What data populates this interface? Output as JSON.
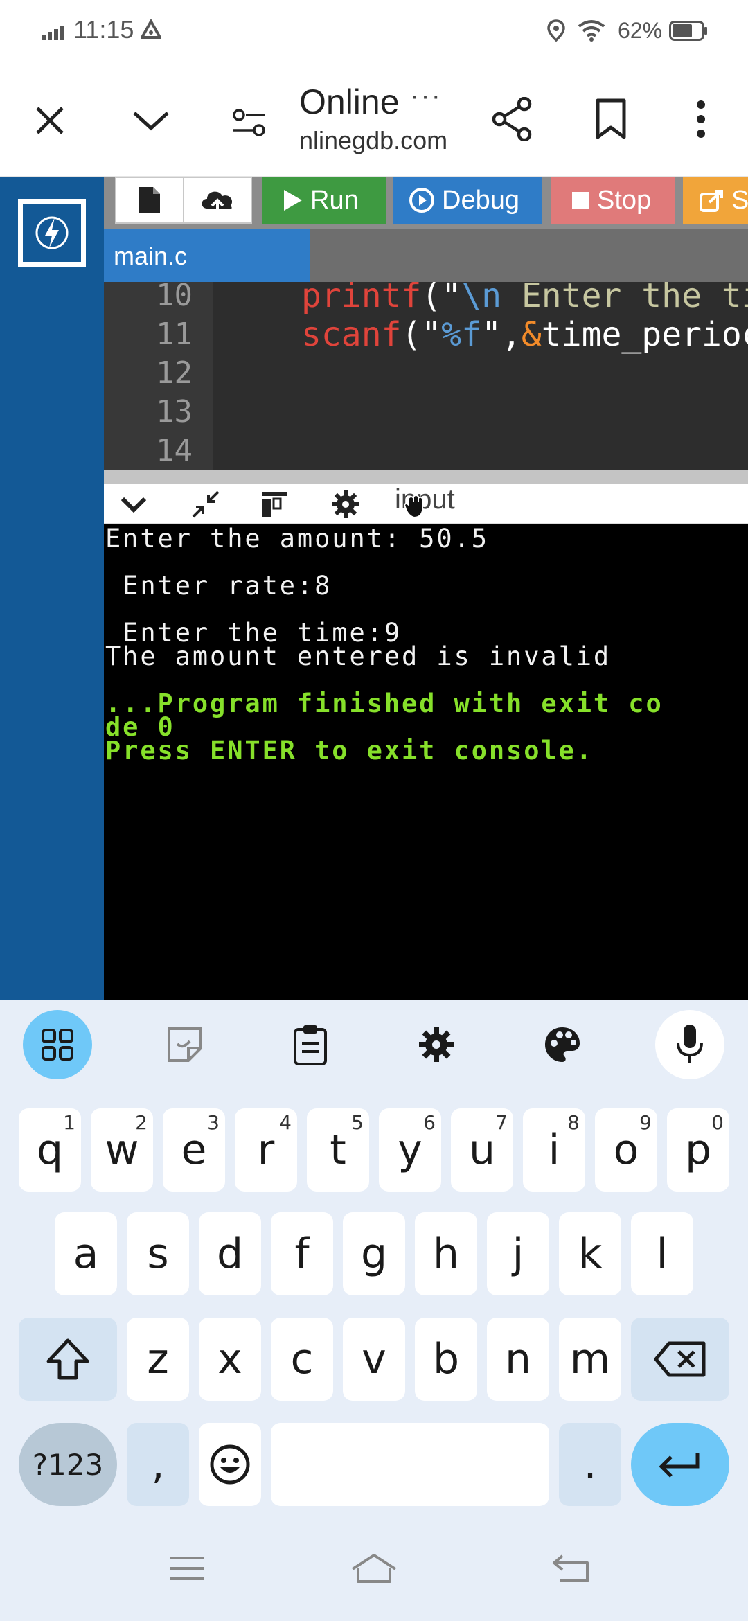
{
  "status_bar": {
    "time": "11:15",
    "battery_percent": "62%",
    "icons": [
      "signal-icon",
      "alert-icon",
      "location-icon",
      "wifi-icon",
      "battery-icon"
    ]
  },
  "browser": {
    "title": "Online",
    "title_more": "···",
    "domain": "nlinegdb.com",
    "icons": [
      "close-icon",
      "chevron-down-icon",
      "site-settings-icon",
      "share-icon",
      "bookmark-icon",
      "more-vert-icon"
    ]
  },
  "toolbar": {
    "run_label": "Run",
    "debug_label": "Debug",
    "stop_label": "Stop",
    "share_label": "S",
    "colors": {
      "run": "#3e9a41",
      "debug": "#2f7cc7",
      "stop": "#e07a7a",
      "share": "#f1a53a"
    }
  },
  "tabs": {
    "active": "main.c"
  },
  "editor": {
    "line_numbers": [
      "10",
      "11",
      "12",
      "13",
      "14"
    ],
    "line10": {
      "fn": "printf",
      "open": "(\"",
      "esc": "\\n",
      "text": " Enter the ti"
    },
    "line11": {
      "fn": "scanf",
      "open": "(\"",
      "fmt": "%f",
      "close": "\",",
      "amp": "&",
      "rest": "time_perioc"
    }
  },
  "io_panel": {
    "label": "input"
  },
  "console": {
    "lines": [
      "Enter the amount: 50.5",
      " Enter rate:8",
      " Enter the time:9",
      "The amount entered is invalid",
      "...Program finished with exit co",
      "de 0",
      "Press ENTER to exit console."
    ]
  },
  "keyboard": {
    "row1": [
      "q",
      "w",
      "e",
      "r",
      "t",
      "y",
      "u",
      "i",
      "o",
      "p"
    ],
    "row1_hints": [
      "1",
      "2",
      "3",
      "4",
      "5",
      "6",
      "7",
      "8",
      "9",
      "0"
    ],
    "row2": [
      "a",
      "s",
      "d",
      "f",
      "g",
      "h",
      "j",
      "k",
      "l"
    ],
    "row3": [
      "z",
      "x",
      "c",
      "v",
      "b",
      "n",
      "m"
    ],
    "symbols_label": "?123",
    "comma": ",",
    "period": ".",
    "tools": [
      "apps-grid-icon",
      "sticker-icon",
      "clipboard-icon",
      "settings-icon",
      "palette-icon",
      "mic-icon"
    ],
    "accent": "#6fc8f8"
  },
  "nav_bar": {
    "icons": [
      "menu-icon",
      "home-icon",
      "back-icon"
    ]
  }
}
